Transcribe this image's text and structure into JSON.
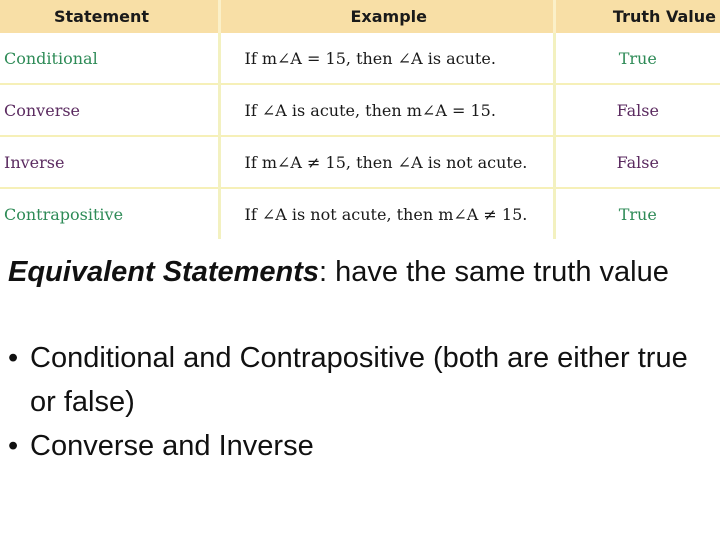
{
  "table": {
    "headers": [
      "Statement",
      "Example",
      "Truth Value"
    ],
    "rows": [
      {
        "statement": "Conditional",
        "example": "If m∠A = 15, then ∠A is acute.",
        "truth": "True",
        "statement_color": "green",
        "truth_color": "green"
      },
      {
        "statement": "Converse",
        "example": "If ∠A is acute, then m∠A = 15.",
        "truth": "False",
        "statement_color": "purple",
        "truth_color": "purple"
      },
      {
        "statement": "Inverse",
        "example": "If m∠A ≠ 15, then ∠A is not acute.",
        "truth": "False",
        "statement_color": "purple",
        "truth_color": "purple"
      },
      {
        "statement": "Contrapositive",
        "example": "If ∠A is not acute, then m∠A ≠ 15.",
        "truth": "True",
        "statement_color": "green",
        "truth_color": "green"
      }
    ]
  },
  "definition": {
    "term": "Equivalent Statements",
    "text": ": have the same truth value"
  },
  "bullets": [
    {
      "symbol": "•",
      "text": "Conditional and Contrapositive  (both are either true or false)"
    },
    {
      "symbol": "•",
      "text": "Converse and Inverse"
    }
  ],
  "colors": {
    "header_bg": "#f8dfa6",
    "green": "#2e8b57",
    "purple": "#5b2b60",
    "grid_line": "#f6f0b8"
  }
}
